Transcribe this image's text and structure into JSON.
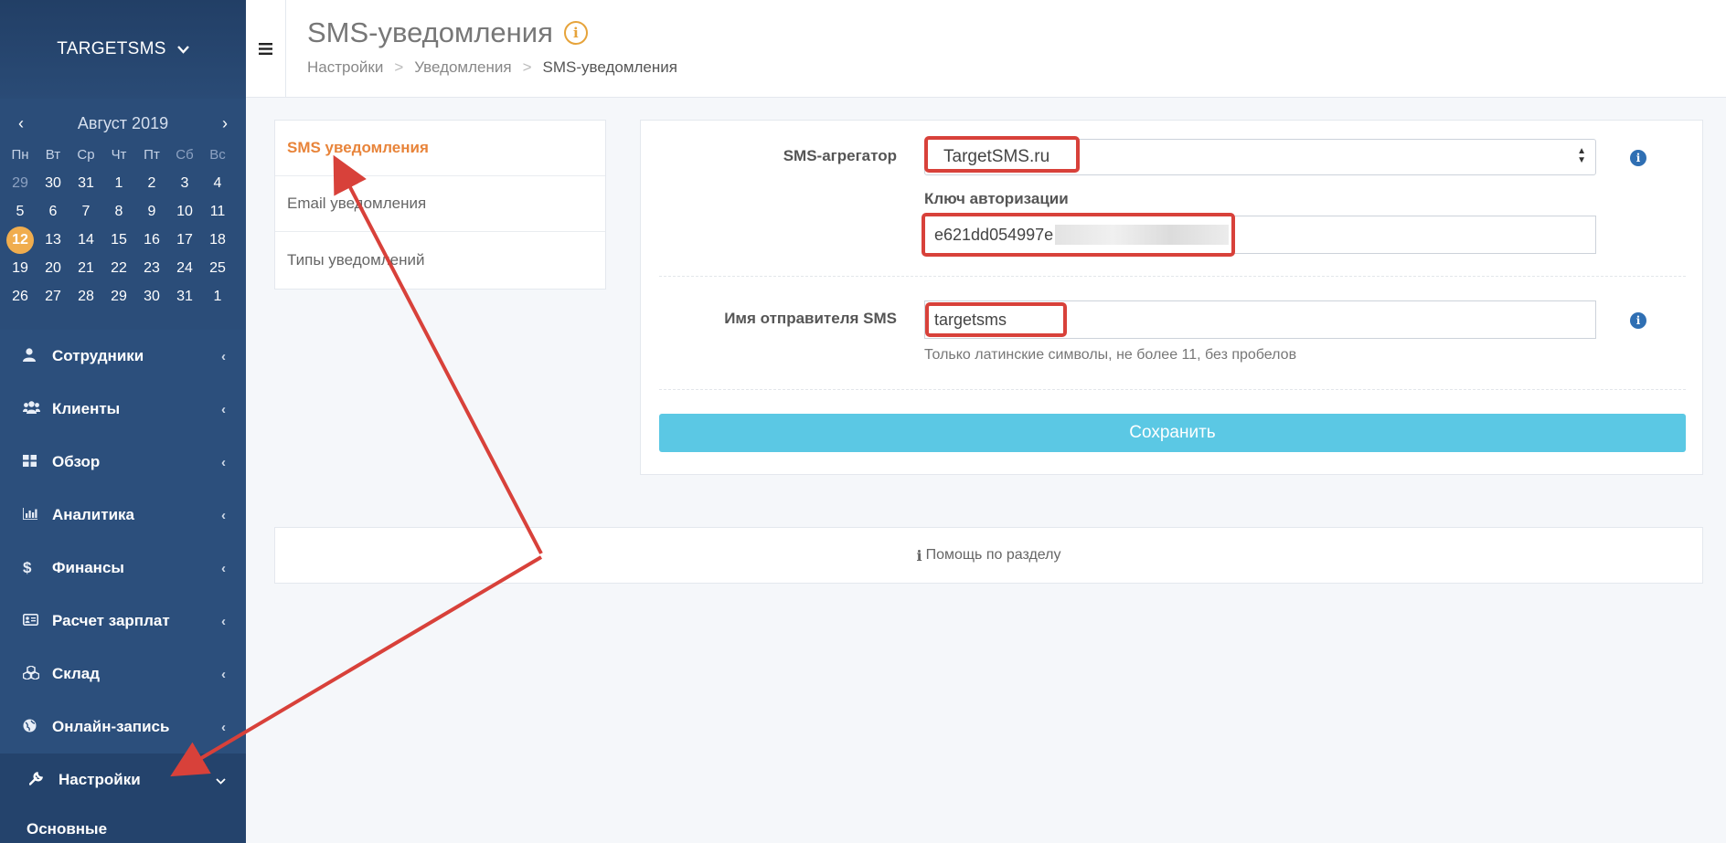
{
  "sidebar": {
    "brand": "TARGETSMS",
    "calendar": {
      "month_label": "Август 2019",
      "weekdays": [
        "Пн",
        "Вт",
        "Ср",
        "Чт",
        "Пт",
        "Сб",
        "Вс"
      ],
      "days": [
        [
          "29",
          "30",
          "31",
          "1",
          "2",
          "3",
          "4"
        ],
        [
          "5",
          "6",
          "7",
          "8",
          "9",
          "10",
          "11"
        ],
        [
          "12",
          "13",
          "14",
          "15",
          "16",
          "17",
          "18"
        ],
        [
          "19",
          "20",
          "21",
          "22",
          "23",
          "24",
          "25"
        ],
        [
          "26",
          "27",
          "28",
          "29",
          "30",
          "31",
          "1"
        ]
      ],
      "today": "12"
    },
    "menu": [
      {
        "label": "Сотрудники",
        "icon": "user-icon"
      },
      {
        "label": "Клиенты",
        "icon": "users-icon"
      },
      {
        "label": "Обзор",
        "icon": "dashboard-icon"
      },
      {
        "label": "Аналитика",
        "icon": "bar-chart-icon"
      },
      {
        "label": "Финансы",
        "icon": "dollar-icon"
      },
      {
        "label": "Расчет зарплат",
        "icon": "id-card-icon"
      },
      {
        "label": "Склад",
        "icon": "cubes-icon"
      },
      {
        "label": "Онлайн-запись",
        "icon": "globe-icon"
      },
      {
        "label": "Настройки",
        "icon": "wrench-icon"
      }
    ],
    "submenu_item": "Основные"
  },
  "header": {
    "title": "SMS-уведомления",
    "breadcrumb": [
      "Настройки",
      "Уведомления",
      "SMS-уведомления"
    ]
  },
  "tabs": [
    "SMS уведомления",
    "Email уведомления",
    "Типы уведомлений"
  ],
  "form": {
    "aggregator_label": "SMS-агрегатор",
    "aggregator_value": "TargetSMS.ru",
    "auth_key_label": "Ключ авторизации",
    "auth_key_value": "e621dd054997e",
    "sender_label": "Имя отправителя SMS",
    "sender_value": "targetsms",
    "sender_hint": "Только латинские символы, не более 11, без пробелов",
    "save_label": "Сохранить"
  },
  "help": {
    "label": "Помощь по разделу"
  },
  "colors": {
    "sidebar": "#2c4f7c",
    "accent_orange": "#e8843a",
    "save_button": "#5bc8e4",
    "annotation_red": "#d8413a",
    "today_badge": "#f0ad4e"
  }
}
